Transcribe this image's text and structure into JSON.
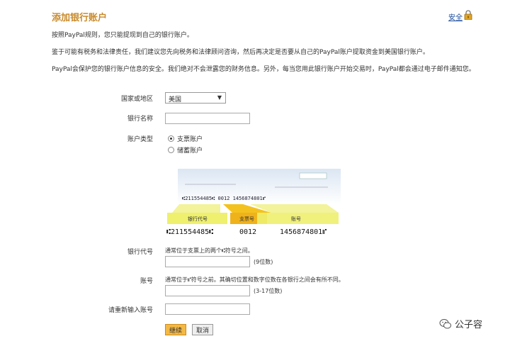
{
  "header": {
    "title": "添加银行账户",
    "security_link": "安全"
  },
  "intro": {
    "p1": "按照PayPal规则，您只能提现到自己的银行账户。",
    "p2": "鉴于可能有税务和法律责任，我们建议您先向税务和法律顾问咨询，然后再决定是否要从自己的PayPal账户提取资金到美国银行账户。",
    "p3": "PayPal会保护您的银行账户信息的安全。我们绝对不会泄露您的财务信息。另外，每当您用此银行账户开始交易时，PayPal都会通过电子邮件通知您。"
  },
  "form": {
    "country_label": "国家或地区",
    "country_value": "美国",
    "bank_name_label": "银行名称",
    "account_type_label": "账户类型",
    "account_type_options": [
      "支票账户",
      "储蓄账户"
    ],
    "routing_label": "银行代号",
    "routing_hint": "通常位于支票上的两个⑆符号之间。",
    "routing_suffix": "(9位数)",
    "account_label": "账号",
    "account_hint": "通常位于⑈符号之前。其确切位置和数字位数在各银行之间会有所不同。",
    "account_suffix": "(3-17位数)",
    "reenter_label": "请重新输入账号",
    "continue_button": "继续",
    "cancel_button": "取消"
  },
  "check_illustration": {
    "small_micr": "⑆211554485⑆  0012  1456874801⑈",
    "routing_tag": "银行代号",
    "check_no_tag": "支票号",
    "account_tag": "账号",
    "big_routing": "⑆211554485⑆",
    "big_check_no": "0012",
    "big_account": "1456874801⑈"
  },
  "watermark": {
    "text": "公子容"
  }
}
